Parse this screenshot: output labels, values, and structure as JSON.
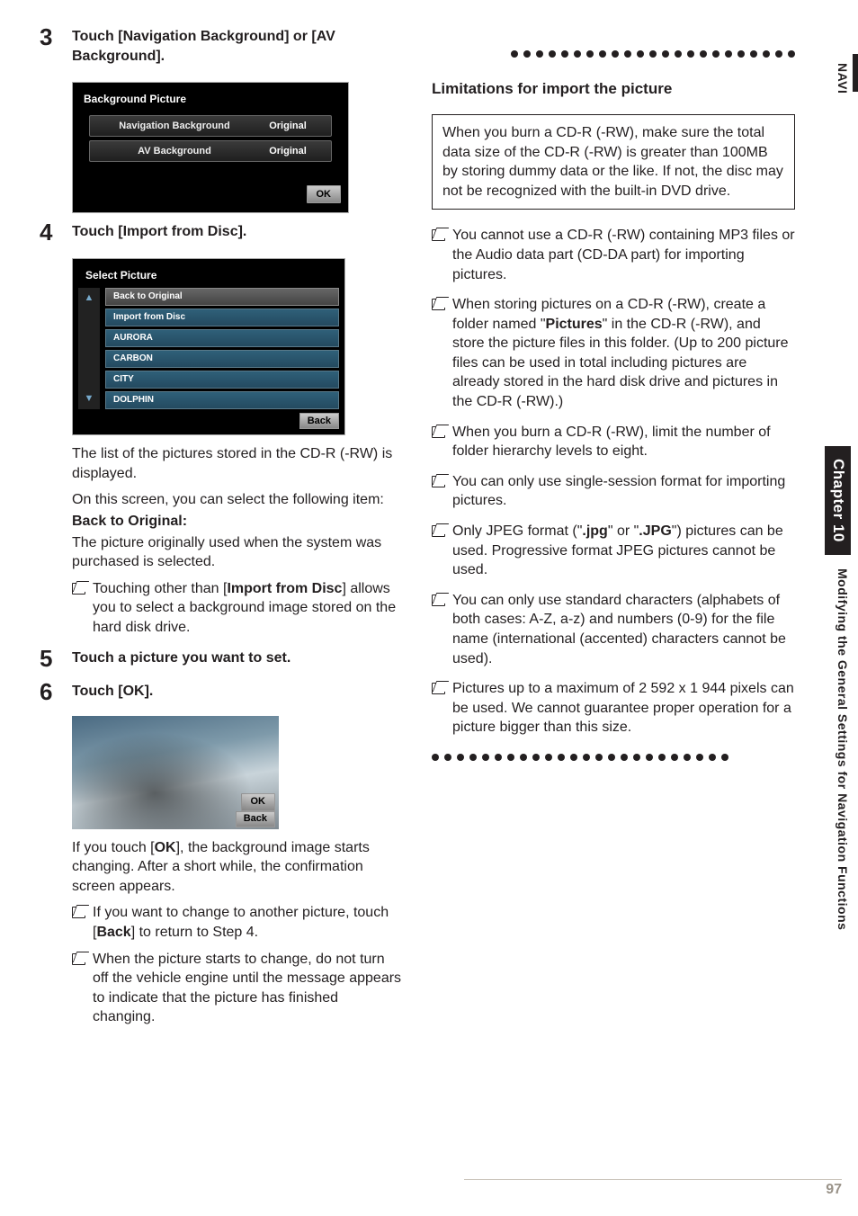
{
  "sidebar": {
    "navi": "NAVI",
    "chapter": "Chapter 10",
    "mod": "Modifying the General Settings for Navigation Functions"
  },
  "page_number": "97",
  "left": {
    "step3": {
      "num": "3",
      "head": "Touch [Navigation Background] or [AV Background]."
    },
    "ss1": {
      "title": "Background Picture",
      "row1": {
        "lbl": "Navigation Background",
        "val": "Original"
      },
      "row2": {
        "lbl": "AV Background",
        "val": "Original"
      },
      "ok": "OK"
    },
    "step4": {
      "num": "4",
      "head": "Touch [Import from Disc]."
    },
    "ss2": {
      "title": "Select Picture",
      "items": [
        "Back to Original",
        "Import from Disc",
        "AURORA",
        "CARBON",
        "CITY",
        "DOLPHIN"
      ],
      "back": "Back"
    },
    "p1": "The list of the pictures stored in the CD-R (-RW) is displayed.",
    "p2": "On this screen, you can select the following item:",
    "back_to_original_label": "Back to Original:",
    "p3": "The picture originally used when the system was purchased is selected.",
    "b1_a": "Touching other than [",
    "b1_bold": "Import from Disc",
    "b1_b": "] allows you to select a background image stored on the hard disk drive.",
    "step5": {
      "num": "5",
      "head": "Touch a picture you want to set."
    },
    "step6": {
      "num": "6",
      "head": "Touch [OK]."
    },
    "ss3": {
      "ok": "OK",
      "back": "Back"
    },
    "p4_a": "If you touch [",
    "p4_bold": "OK",
    "p4_b": "], the background image starts changing. After a short while, the confirmation screen appears.",
    "b2_a": "If you want to change to another picture, touch [",
    "b2_bold": "Back",
    "b2_b": "] to return to Step 4.",
    "b3": "When the picture starts to change, do not turn off the vehicle engine until the message appears to indicate that the picture has finished changing."
  },
  "right": {
    "sub": "Limitations for import the picture",
    "note": "When you burn a CD-R (-RW), make sure the total data size of the CD-R (-RW) is greater than 100MB by storing dummy data or the like. If not, the disc may not be recognized with the built-in DVD drive.",
    "b1": "You cannot use a CD-R (-RW) containing MP3 files or the Audio data part (CD-DA part) for importing pictures.",
    "b2_a": "When storing pictures on a CD-R (-RW), create a folder named \"",
    "b2_bold": "Pictures",
    "b2_b": "\" in the CD-R (-RW), and store the picture files in this folder. (Up to 200 picture files can be used in total including pictures are already stored in the hard disk drive and pictures in the CD-R (-RW).)",
    "b3": "When you burn a CD-R (-RW), limit the number of folder hierarchy levels to eight.",
    "b4": "You can only use single-session format for importing pictures.",
    "b5_a": "Only JPEG format (\"",
    "b5_bold1": ".jpg",
    "b5_mid": "\" or \"",
    "b5_bold2": ".JPG",
    "b5_b": "\") pictures can be used. Progressive format JPEG pictures cannot be used.",
    "b6": "You can only use standard characters (alphabets of both cases: A-Z, a-z) and numbers (0-9) for the file name (international (accented) characters cannot be used).",
    "b7": "Pictures up to a maximum of 2 592 x 1 944 pixels can be used. We cannot guarantee proper operation for a picture bigger than this size."
  }
}
